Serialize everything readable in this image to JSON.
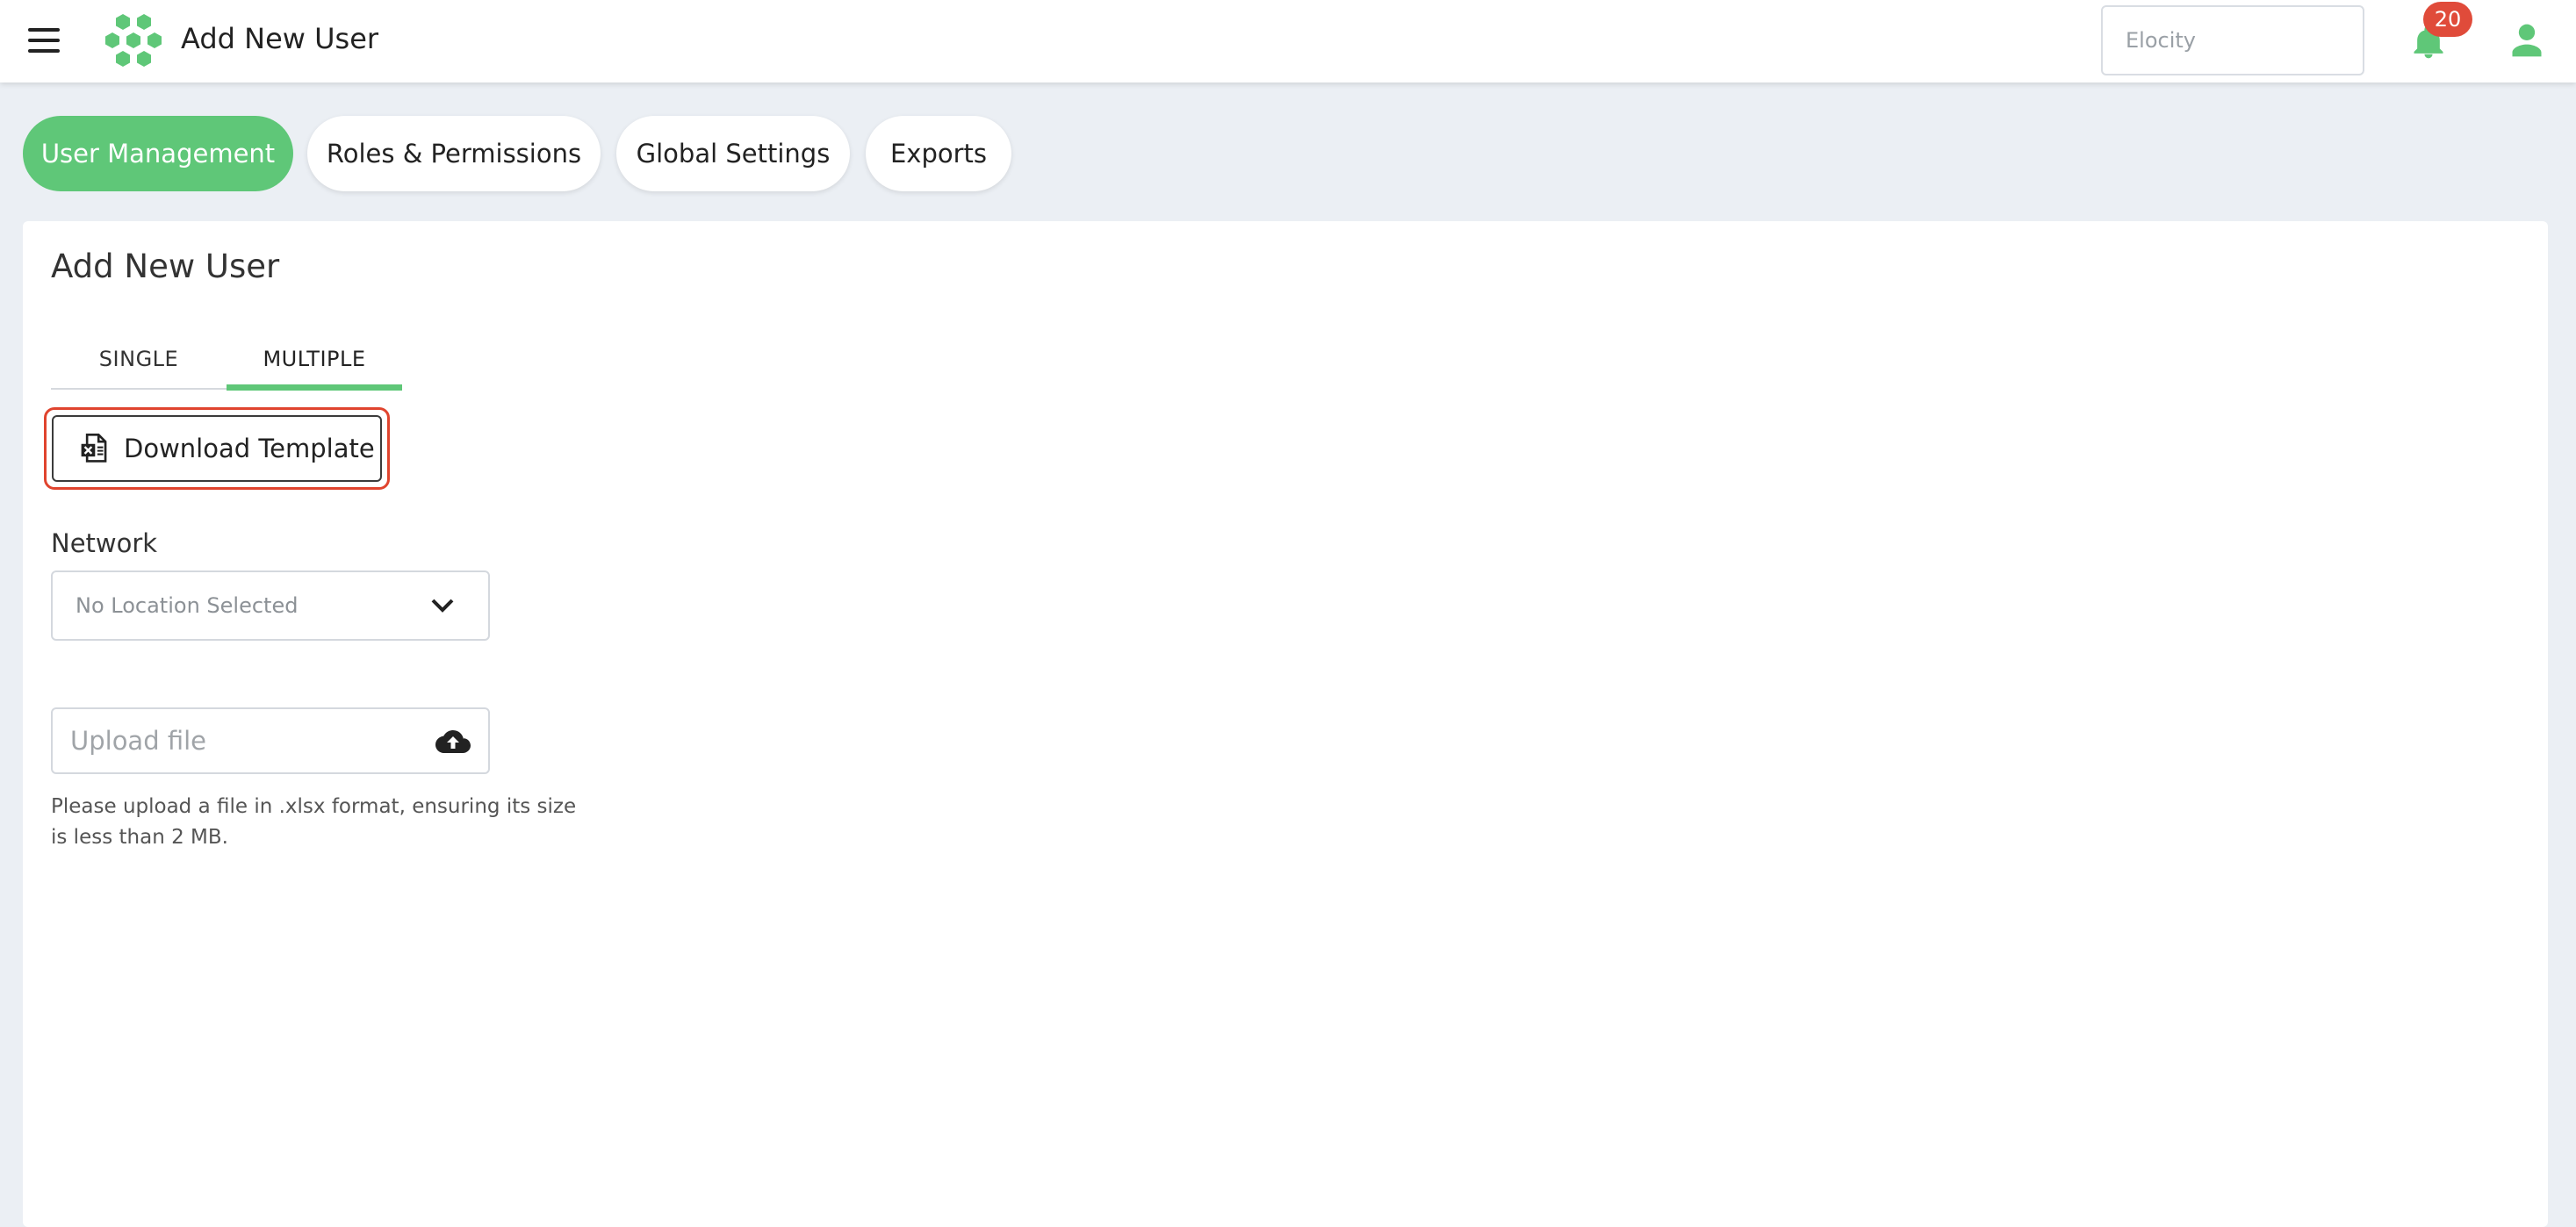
{
  "header": {
    "title": "Add New User",
    "tenant_placeholder": "Elocity",
    "notification_count": "20"
  },
  "nav": {
    "pills": [
      {
        "label": "User Management",
        "active": true
      },
      {
        "label": "Roles & Permissions",
        "active": false
      },
      {
        "label": "Global Settings",
        "active": false
      },
      {
        "label": "Exports",
        "active": false
      }
    ]
  },
  "form": {
    "title": "Add New User",
    "tabs": [
      {
        "label": "SINGLE",
        "active": false
      },
      {
        "label": "MULTIPLE",
        "active": true
      }
    ],
    "download_label": "Download Template",
    "network_label": "Network",
    "network_value": "No Location Selected",
    "upload_placeholder": "Upload file",
    "hint": "Please upload a file in .xlsx format, ensuring its size is less than 2 MB."
  },
  "colors": {
    "accent": "#5fc778",
    "badge": "#e04b3a",
    "highlight": "#e0442e",
    "background": "#ebeff4"
  },
  "icons": [
    "menu-icon",
    "hexagon-logo-icon",
    "bell-icon",
    "user-icon",
    "excel-file-icon",
    "chevron-down-icon",
    "cloud-upload-icon"
  ]
}
